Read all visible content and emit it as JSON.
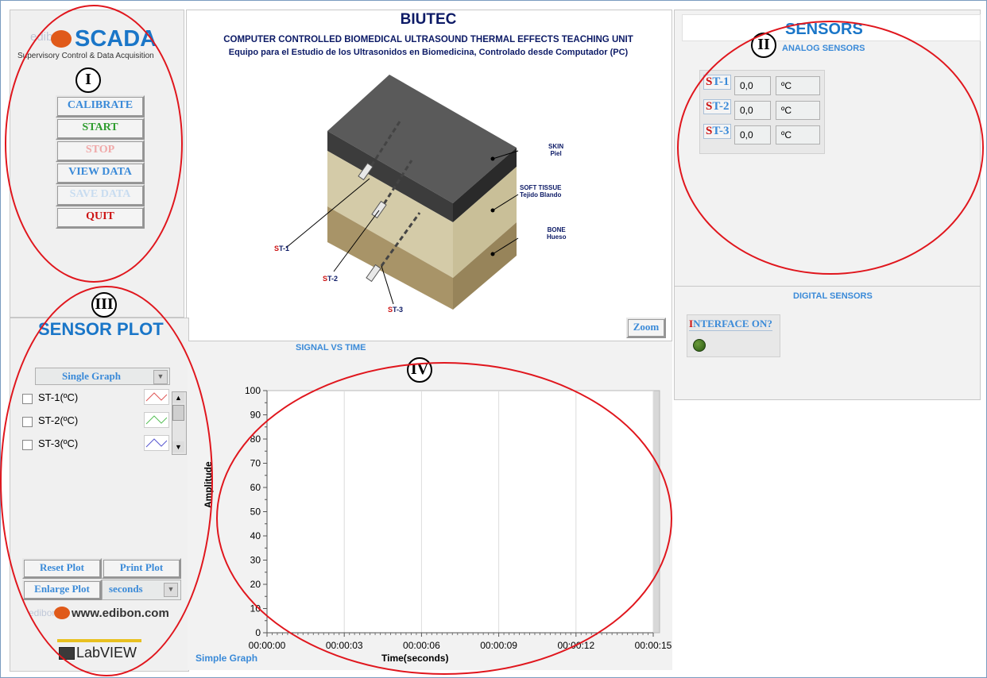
{
  "header": {
    "title": "BIUTEC",
    "subtitle_en": "COMPUTER CONTROLLED BIOMEDICAL ULTRASOUND THERMAL EFFECTS TEACHING UNIT",
    "subtitle_es": "Equipo para el Estudio de los Ultrasonidos en Biomedicina, Controlado desde Computador (PC)"
  },
  "logo": {
    "brand": "edibon",
    "product": "SCADA",
    "tagline": "Supervisory Control & Data Acquisition",
    "website": "www.edibon.com",
    "labview": "LabVIEW"
  },
  "markers": {
    "m1": "I",
    "m2": "II",
    "m3": "III",
    "m4": "IV"
  },
  "controls": {
    "calibrate": "CALIBRATE",
    "start": "START",
    "stop": "STOP",
    "view_data": "VIEW DATA",
    "save_data": "SAVE DATA",
    "quit": "QUIT"
  },
  "diagram": {
    "skin": "SKIN",
    "skin_es": "Piel",
    "soft": "SOFT TISSUE",
    "soft_es": "Tejido Blando",
    "bone": "BONE",
    "bone_es": "Hueso",
    "st1_prefix": "S",
    "st1_suffix": "T-1",
    "st2_prefix": "S",
    "st2_suffix": "T-2",
    "st3_prefix": "S",
    "st3_suffix": "T-3",
    "zoom": "Zoom"
  },
  "sensors": {
    "title": "SENSORS",
    "analog_title": "ANALOG SENSORS",
    "analog": [
      {
        "prefix": "S",
        "suffix": "T-1",
        "value": "0,0",
        "unit": "ºC"
      },
      {
        "prefix": "S",
        "suffix": "T-2",
        "value": "0,0",
        "unit": "ºC"
      },
      {
        "prefix": "S",
        "suffix": "T-3",
        "value": "0,0",
        "unit": "ºC"
      }
    ],
    "digital_title": "DIGITAL SENSORS",
    "interface_prefix": "I",
    "interface_suffix": "NTERFACE ON?",
    "led_color": "#2a5a12"
  },
  "plot_panel": {
    "title": "SENSOR PLOT",
    "graph_mode": "Single Graph",
    "channels": [
      {
        "label": "ST-1(ºC)",
        "color": "#e05858"
      },
      {
        "label": "ST-2(ºC)",
        "color": "#58c058"
      },
      {
        "label": "ST-3(ºC)",
        "color": "#5858d0"
      }
    ],
    "reset": "Reset Plot",
    "print": "Print Plot",
    "enlarge": "Enlarge Plot",
    "time_unit": "seconds"
  },
  "chart_data": {
    "type": "line",
    "title": "SIGNAL VS TIME",
    "xlabel": "Time(seconds)",
    "ylabel": "Amplitude",
    "x_ticks": [
      "00:00:00",
      "00:00:03",
      "00:00:06",
      "00:00:09",
      "00:00:12",
      "00:00:15"
    ],
    "y_ticks": [
      "0",
      "10",
      "20",
      "30",
      "40",
      "50",
      "60",
      "70",
      "80",
      "90",
      "100"
    ],
    "ylim": [
      0,
      100
    ],
    "xlim": [
      0,
      15
    ],
    "grid": true,
    "series": [],
    "caption": "Simple Graph"
  }
}
